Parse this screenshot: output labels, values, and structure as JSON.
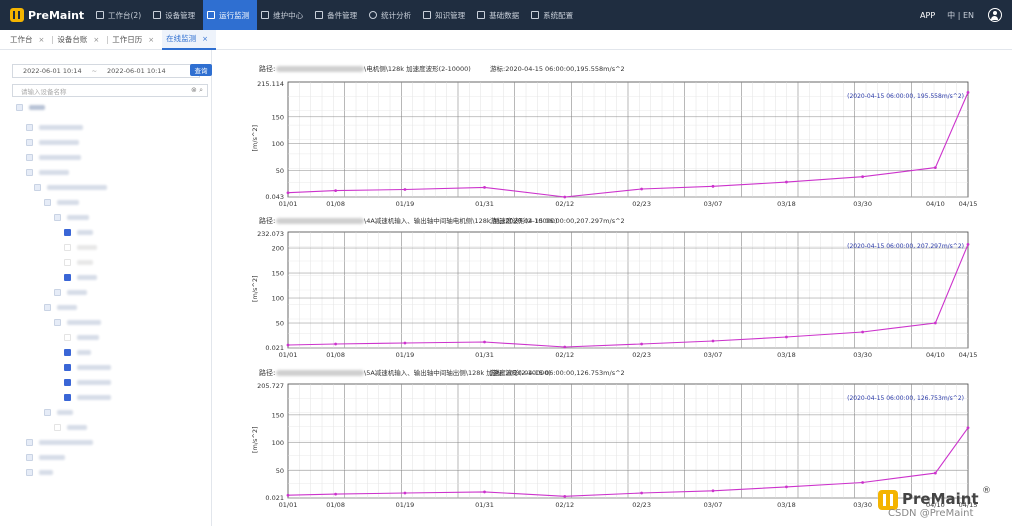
{
  "brand": {
    "name": "PreMaint",
    "logo_color": "#f4b400"
  },
  "nav": [
    {
      "label": "工作台(2)",
      "icon": "workbench-icon"
    },
    {
      "label": "设备管理",
      "icon": "device-icon"
    },
    {
      "label": "运行监测",
      "icon": "monitor-icon",
      "active": true
    },
    {
      "label": "维护中心",
      "icon": "wrench-icon"
    },
    {
      "label": "备件管理",
      "icon": "parts-icon"
    },
    {
      "label": "统计分析",
      "icon": "pie-icon"
    },
    {
      "label": "知识管理",
      "icon": "book-icon"
    },
    {
      "label": "基础数据",
      "icon": "data-icon"
    },
    {
      "label": "系统配置",
      "icon": "settings-icon"
    }
  ],
  "top_right": {
    "app": "APP",
    "lang_cn": "中",
    "lang_sep": "|",
    "lang_en": "EN"
  },
  "tabs": [
    {
      "label": "工作台"
    },
    {
      "label": "设备台账"
    },
    {
      "label": "工作日历"
    },
    {
      "label": "在线监测",
      "active": true
    }
  ],
  "tab_close": "×",
  "sidebar": {
    "date_start": "2022-06-01 10:14",
    "date_sep": "~",
    "date_end": "2022-06-01 10:14",
    "query_label": "查询",
    "search_placeholder": "请输入设备名称",
    "search_icons": "⊗ ⌕",
    "root_label": "集团"
  },
  "charts": [
    {
      "path_prefix": "路径:",
      "path_suffix": "\\电机侧\\128k 加速度波形(2-10000)",
      "cursor": "游标:2020-04-15 06:00:00,195.558m/s^2",
      "annotation": "(2020-04-15 06:00:00, 195.558m/s^2)",
      "ylabel": "[m/s^2]",
      "ymax_label": "215.114",
      "ymin_label": "0.043",
      "yticks": [
        "150",
        "100",
        "50"
      ]
    },
    {
      "path_prefix": "路径:",
      "path_suffix": "\\4A减速机输入、输出轴中间轴电机侧\\128k 加速度波形(2-10000)",
      "cursor": "游标:2020-04-15 06:00:00,207.297m/s^2",
      "annotation": "(2020-04-15 06:00:00, 207.297m/s^2)",
      "ylabel": "[m/s^2]",
      "ymax_label": "232.073",
      "ymin_label": "0.021",
      "yticks": [
        "200",
        "150",
        "100",
        "50"
      ]
    },
    {
      "path_prefix": "路径:",
      "path_suffix": "\\5A减速机输入、输出轴中间轴出侧\\128k 加速度波形(2-10000)",
      "cursor": "游标:2020-04-15 06:00:00,126.753m/s^2",
      "annotation": "(2020-04-15 06:00:00, 126.753m/s^2)",
      "ylabel": "[m/s^2]",
      "ymax_label": "205.727",
      "ymin_label": "0.021",
      "yticks": [
        "150",
        "100",
        "50"
      ]
    }
  ],
  "x_ticks": [
    "01/01",
    "01/08",
    "01/19",
    "01/31",
    "02/12",
    "02/23",
    "03/07",
    "03/18",
    "03/30",
    "04/10",
    "04/15"
  ],
  "watermark": {
    "name": "PreMaint",
    "reg": "®",
    "csdn": "CSDN @PreMaint"
  },
  "colors": {
    "accent": "#2f6fd1",
    "topbar": "#1f2d40",
    "series": "#cc33cc",
    "annotation": "#2a3aa8"
  },
  "chart_data": [
    {
      "type": "line",
      "title": "",
      "ylabel": "[m/s^2]",
      "ylim": [
        0.043,
        215.114
      ],
      "categories": [
        "01/01",
        "01/08",
        "01/19",
        "01/31",
        "02/12",
        "02/23",
        "03/07",
        "03/18",
        "03/30",
        "04/10",
        "04/15"
      ],
      "series": [
        {
          "values": [
            8,
            12,
            14,
            18,
            0,
            15,
            20,
            28,
            38,
            55,
            195.558
          ]
        }
      ]
    },
    {
      "type": "line",
      "title": "",
      "ylabel": "[m/s^2]",
      "ylim": [
        0.021,
        232.073
      ],
      "categories": [
        "01/01",
        "01/08",
        "01/19",
        "01/31",
        "02/12",
        "02/23",
        "03/07",
        "03/18",
        "03/30",
        "04/10",
        "04/15"
      ],
      "series": [
        {
          "values": [
            6,
            8,
            10,
            12,
            2,
            8,
            14,
            22,
            32,
            50,
            207.297
          ]
        }
      ]
    },
    {
      "type": "line",
      "title": "",
      "ylabel": "[m/s^2]",
      "ylim": [
        0.021,
        205.727
      ],
      "categories": [
        "01/01",
        "01/08",
        "01/19",
        "01/31",
        "02/12",
        "02/23",
        "03/07",
        "03/18",
        "03/30",
        "04/10",
        "04/15"
      ],
      "series": [
        {
          "values": [
            5,
            7,
            9,
            11,
            3,
            9,
            13,
            20,
            28,
            45,
            126.753
          ]
        }
      ]
    }
  ]
}
